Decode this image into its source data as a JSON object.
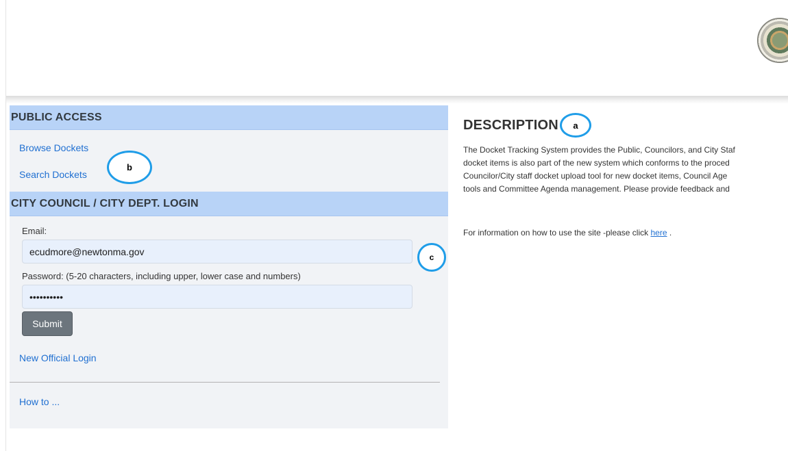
{
  "public_access": {
    "title": "PUBLIC ACCESS",
    "links": [
      "Browse Dockets",
      "Search Dockets"
    ]
  },
  "council_login": {
    "title": "CITY COUNCIL / CITY DEPT. LOGIN",
    "email_label": "Email:",
    "email_value": "ecudmore@newtonma.gov",
    "password_label": "Password: (5-20 characters, including upper, lower case and numbers)",
    "password_value": "••••••••••",
    "submit_label": "Submit",
    "new_official_label": "New Official Login"
  },
  "howto_label": "How to ...",
  "description": {
    "title": "DESCRIPTION",
    "lines": [
      "The Docket Tracking System provides the Public, Councilors, and City Staf",
      "docket items is also part of the new system which conforms to the proced",
      "Councilor/City staff docket upload tool for new docket items, Council Age",
      "tools and Committee Agenda management. Please provide feedback and"
    ],
    "info_prefix": "For information on how to use the site -please click ",
    "info_link": "here",
    "info_suffix": "."
  },
  "callouts": {
    "a": "a",
    "b": "b",
    "c": "c"
  },
  "logo": {
    "name": "city-seal-icon"
  }
}
